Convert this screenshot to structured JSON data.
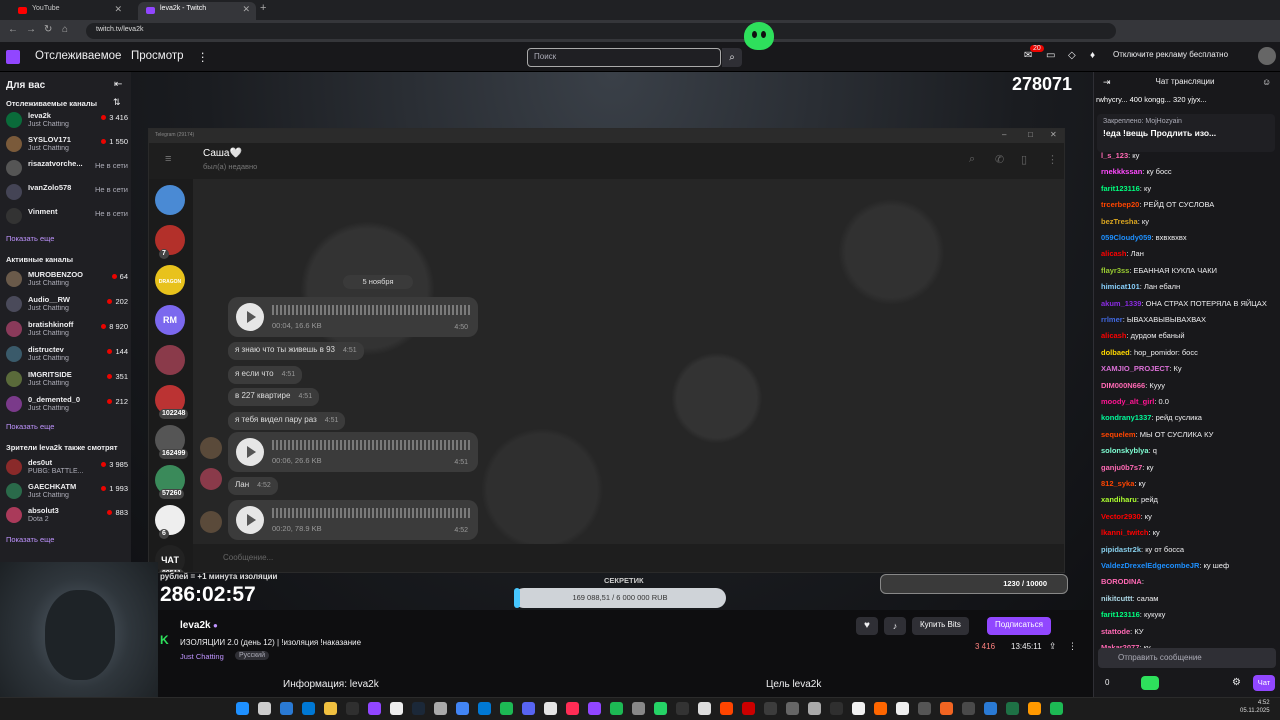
{
  "browser": {
    "tabs": [
      {
        "label": "YouTube",
        "color": "#ff0000"
      },
      {
        "label": "leva2k - Twitch",
        "color": "#9146ff"
      }
    ],
    "url": "twitch.tv/leva2k"
  },
  "topnav": {
    "following": "Отслеживаемое",
    "browse": "Просмотр",
    "search_placeholder": "Поиск",
    "notif_count": "20",
    "adfree": "Отключите рекламу бесплатно"
  },
  "sidebar": {
    "title": "Для вас",
    "followed_header": "Отслеживаемые каналы",
    "followed": [
      {
        "name": "leva2k",
        "cat": "Just Chatting",
        "viewers": "3 416",
        "live": true,
        "color": "#0a6b3a"
      },
      {
        "name": "SYSLOV171",
        "cat": "Just Chatting",
        "viewers": "1 550",
        "live": true,
        "color": "#7a5a3a"
      },
      {
        "name": "risazatvorche...",
        "cat": "",
        "viewers": "Не в сети",
        "live": false,
        "color": "#555"
      },
      {
        "name": "IvanZolo578",
        "cat": "",
        "viewers": "Не в сети",
        "live": false,
        "color": "#445"
      },
      {
        "name": "Vinment",
        "cat": "",
        "viewers": "Не в сети",
        "live": false,
        "color": "#333"
      }
    ],
    "show_more": "Показать еще",
    "active_header": "Активные каналы",
    "active": [
      {
        "name": "MUROBENZOO",
        "cat": "Just Chatting",
        "viewers": "64",
        "color": "#6a5a4a"
      },
      {
        "name": "Audio__RW",
        "cat": "Just Chatting",
        "viewers": "202",
        "color": "#4a4a5a"
      },
      {
        "name": "bratishkinoff",
        "cat": "Just Chatting",
        "viewers": "8 920",
        "color": "#8a3a5a"
      },
      {
        "name": "distructev",
        "cat": "Just Chatting",
        "viewers": "144",
        "color": "#3a5a6a"
      },
      {
        "name": "IMGRITSIDE",
        "cat": "Just Chatting",
        "viewers": "351",
        "color": "#5a6a3a"
      },
      {
        "name": "0_demented_0",
        "cat": "Just Chatting",
        "viewers": "212",
        "color": "#7a3a8a"
      }
    ],
    "also_header": "Зрители leva2k также смотрят",
    "also": [
      {
        "name": "des0ut",
        "cat": "PUBG: BATTLE...",
        "viewers": "3 985",
        "color": "#8a2a2a"
      },
      {
        "name": "GAECHKATM",
        "cat": "Just Chatting",
        "viewers": "1 993",
        "color": "#2a6a4a"
      },
      {
        "name": "absolut3",
        "cat": "Dota 2",
        "viewers": "883",
        "color": "#aa3a5a"
      }
    ]
  },
  "stream": {
    "viewer_overlay": "278071",
    "timer": "286:02:57",
    "timer_caption": "рублей = +1 минута изоляции",
    "goal_label": "СЕКРЕТИК",
    "goal_value": "169 088,51 / 6 000 000 RUB",
    "goal_fraction": 0.028,
    "sub_goal": "1230 / 10000",
    "name": "leva2k",
    "title": "ИЗОЛЯЦИИ 2.0 (день 12) | !изоляция !наказание",
    "category": "Just Chatting",
    "language": "Русский",
    "viewers": "3 416",
    "uptime": "13:45:11",
    "bits_btn": "Купить Bits",
    "sub_btn": "Подписаться",
    "about": "Информация: leva2k",
    "goal_header": "Цель leva2k"
  },
  "telegram": {
    "window_title": "Telegram (29174)",
    "contact": "Саша🤍",
    "status": "был(а) недавно",
    "date": "5 ноября",
    "input_placeholder": "Сообщение...",
    "rail": [
      {
        "label": "",
        "color": "#4a8ad4",
        "badge": ""
      },
      {
        "label": "",
        "color": "#b3302a",
        "badge": "7"
      },
      {
        "label": "DRAGON MONEY",
        "color": "#e8c21c",
        "badge": ""
      },
      {
        "label": "RM",
        "color": "#7b68ee",
        "badge": ""
      },
      {
        "label": "",
        "color": "#8a3a4a",
        "badge": ""
      },
      {
        "label": "",
        "color": "#b33",
        "badge": "102248"
      },
      {
        "label": "",
        "color": "#555",
        "badge": "162499"
      },
      {
        "label": "",
        "color": "#3a8a5a",
        "badge": "57260"
      },
      {
        "label": "",
        "color": "#eee",
        "badge": "6"
      },
      {
        "label": "ЧАТ",
        "color": "#222",
        "badge": "89511"
      }
    ],
    "messages": [
      {
        "kind": "voice",
        "meta": "00:04, 16.6 KB",
        "time": "4:50"
      },
      {
        "kind": "text",
        "text": "я знаю что ты живешь в 93",
        "time": "4:51"
      },
      {
        "kind": "text",
        "text": "я если что",
        "time": "4:51"
      },
      {
        "kind": "text",
        "text": "в 227 квартире",
        "time": "4:51"
      },
      {
        "kind": "text",
        "text": "я тебя видел пару раз",
        "time": "4:51"
      },
      {
        "kind": "voice",
        "meta": "00:06, 26.6 KB",
        "time": "4:51"
      },
      {
        "kind": "text",
        "text": "Лан",
        "time": "4:52"
      },
      {
        "kind": "voice",
        "meta": "00:20, 78.9 KB",
        "time": "4:52"
      }
    ]
  },
  "chat": {
    "header": "Чат трансляции",
    "top_bar": "rwhycry... 400  kongg... 320  yjyx...",
    "pinned_by": "Закреплено: MojHozyain",
    "pinned_text": "!еда !вещь Продлить изо...",
    "messages": [
      {
        "user": "l_s_123",
        "text": "ку",
        "color": "#ff69b4"
      },
      {
        "user": "rnekkkssan",
        "text": "ку босс",
        "color": "#ff4aff"
      },
      {
        "user": "farit123116",
        "text": "ку",
        "color": "#00ff7f"
      },
      {
        "user": "trcerbep20",
        "text": "РЕЙД ОТ СУСЛОВА",
        "color": "#ff4500"
      },
      {
        "user": "bezTresha",
        "text": "ку",
        "color": "#daa520"
      },
      {
        "user": "059Cloudy059",
        "text": "вхвхвхвх",
        "color": "#1e90ff"
      },
      {
        "user": "alicash",
        "text": "Лан",
        "color": "#ff0000"
      },
      {
        "user": "flayr3ss",
        "text": "ЕБАННАЯ КУКЛА ЧАКИ",
        "color": "#9acd32"
      },
      {
        "user": "himicat101",
        "text": "Лан ебалн",
        "color": "#87cefa"
      },
      {
        "user": "akum_1339",
        "text": "ОНА СТРАХ ПОТЕРЯЛА В ЯЙЦАХ",
        "color": "#8a2be2"
      },
      {
        "user": "rrlmer",
        "text": "ЫВАХАВЫВЫВАХВАХ",
        "color": "#4169e1"
      },
      {
        "user": "alicash",
        "text": "дурдом ебаный",
        "color": "#ff0000"
      },
      {
        "user": "dolbaed",
        "text": "hop_pomidor: босс",
        "color": "#ffd700"
      },
      {
        "user": "XAMJIO_PROJECT",
        "text": "Ку",
        "color": "#da70d6"
      },
      {
        "user": "DIM000N666",
        "text": "Кууу",
        "color": "#ff69b4"
      },
      {
        "user": "moody_alt_girl",
        "text": "0.0",
        "color": "#ff1493"
      },
      {
        "user": "kondrany1337",
        "text": "рейд суслика",
        "color": "#00fa9a"
      },
      {
        "user": "sequelem",
        "text": "МЫ ОТ СУСЛИКА КУ",
        "color": "#ff4500"
      },
      {
        "user": "solonskyblya",
        "text": "q",
        "color": "#7fffd4"
      },
      {
        "user": "ganju0b7s7",
        "text": "ку",
        "color": "#ff69b4"
      },
      {
        "user": "812_syka",
        "text": "ку",
        "color": "#ff4500"
      },
      {
        "user": "xandiharu",
        "text": "рейд",
        "color": "#adff2f"
      },
      {
        "user": "Vector2930",
        "text": "ку",
        "color": "#ff0000"
      },
      {
        "user": "lkanni_twitch",
        "text": "ку",
        "color": "#ff0000"
      },
      {
        "user": "pipidastr2k",
        "text": "ку от босса",
        "color": "#87ceeb"
      },
      {
        "user": "ValdezDrexelEdgecombeJR",
        "text": "ку шеф",
        "color": "#1e90ff"
      },
      {
        "user": "BORODINA",
        "text": "",
        "color": "#ff69b4"
      },
      {
        "user": "nikitcuttt",
        "text": "салам",
        "color": "#add8e6"
      },
      {
        "user": "farit123116",
        "text": "кукуку",
        "color": "#00ff7f"
      },
      {
        "user": "stattode",
        "text": "КУ",
        "color": "#ff69b4"
      },
      {
        "user": "Makar2077",
        "text": "ку",
        "color": "#ff69b4"
      }
    ],
    "input_placeholder": "Отправить сообщение",
    "points": "0",
    "send": "Чат"
  },
  "taskbar": {
    "time": "4:52",
    "date": "05.11.2025"
  }
}
